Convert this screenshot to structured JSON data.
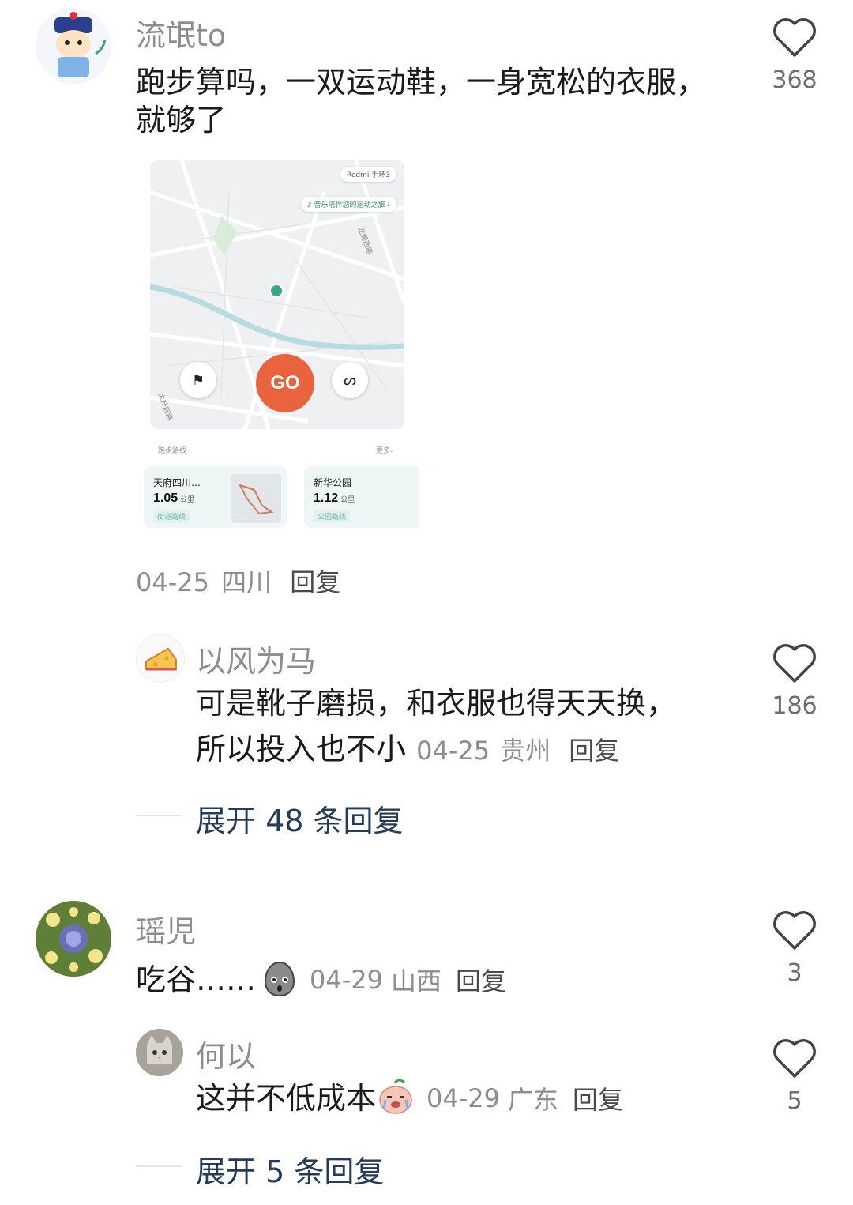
{
  "colors": {
    "accent_go": "#e9643e",
    "name": "#8d8d8d",
    "expand": "#243b5a"
  },
  "comments": [
    {
      "username": "流氓to",
      "text": "跑步算吗，一双运动鞋，一身宽松的衣服，就够了",
      "date": "04-25",
      "location": "四川",
      "reply_label": "回复",
      "likes": "368",
      "avatar_icon": "cartoon-character-avatar"
    }
  ],
  "embedded_app": {
    "device_chip": "Redmi 手环3",
    "music_chip": "音乐陪伴您的运动之旅",
    "go_label": "GO",
    "road_label_1": "大升府路",
    "road_label_2": "龙腾西路",
    "routes_section": "跑步路线",
    "more_label": "更多",
    "routes": [
      {
        "name": "天府四川…",
        "distance": "1.05",
        "unit": "公里",
        "tag": "街道路线"
      },
      {
        "name": "新华公园",
        "distance": "1.12",
        "unit": "公里",
        "tag": "公园路线"
      }
    ]
  },
  "reply1": {
    "username": "以风为马",
    "text_line1": "可是靴子磨损，和衣服也得天天换，",
    "text_line2": "所以投入也不小",
    "date": "04-25",
    "location": "贵州",
    "reply_label": "回复",
    "likes": "186",
    "avatar_icon": "cheese-avatar"
  },
  "expand1": "展开 48 条回复",
  "comment2": {
    "username": "瑶児",
    "text": "吃谷……",
    "date": "04-29",
    "location": "山西",
    "reply_label": "回复",
    "likes": "3",
    "avatar_icon": "flower-avatar"
  },
  "reply2": {
    "username": "何以",
    "text": "这并不低成本",
    "date": "04-29",
    "location": "广东",
    "reply_label": "回复",
    "likes": "5",
    "avatar_icon": "cat-avatar"
  },
  "expand2": "展开 5 条回复"
}
